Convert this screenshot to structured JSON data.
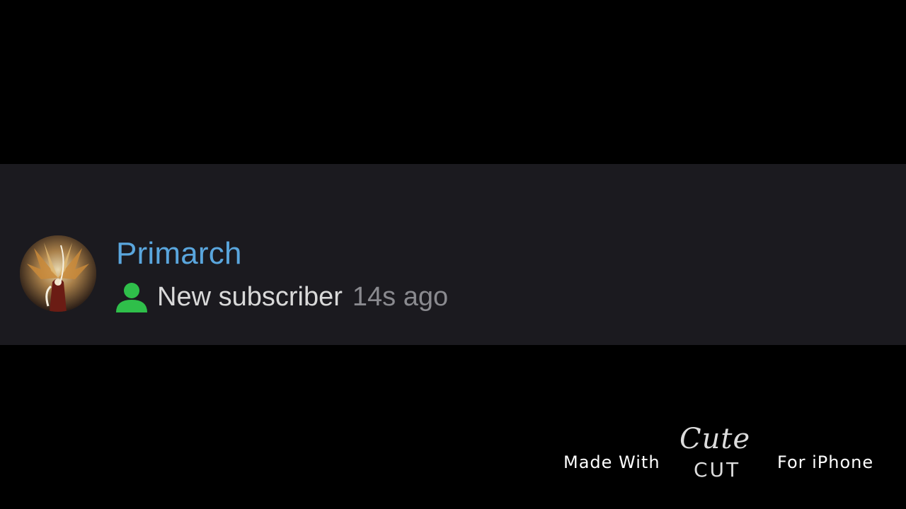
{
  "notification": {
    "username": "Primarch",
    "event_label": "New subscriber",
    "time_ago": "14s ago",
    "icon": "user-icon",
    "colors": {
      "username": "#5aa6dd",
      "icon": "#2fbf4a",
      "band_background": "#1b1a1f"
    }
  },
  "watermark": {
    "made_with": "Made With",
    "logo_script": "Cute",
    "logo_word": "CUT",
    "for_platform": "For iPhone"
  }
}
